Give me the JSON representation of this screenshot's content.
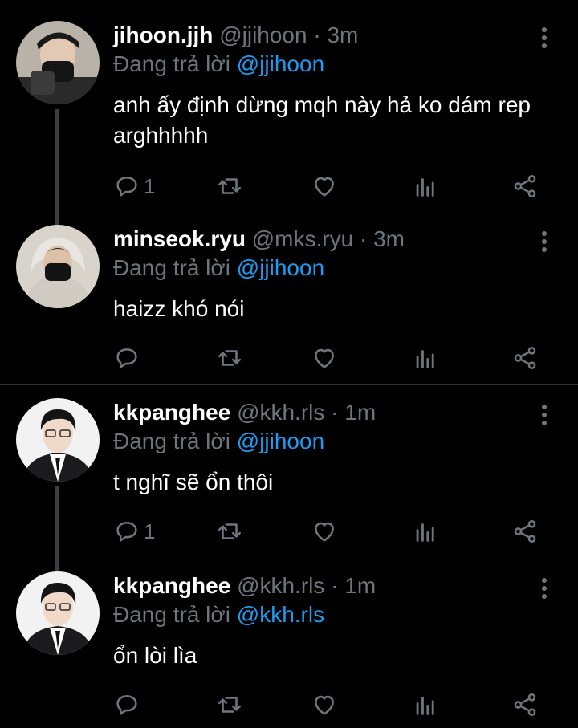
{
  "reply_prefix": "Đang trả lời",
  "tweets": [
    {
      "name": "jihoon.jjh",
      "handle": "@jjihoon",
      "dot": "·",
      "time": "3m",
      "reply_to": "@jjihoon",
      "text": "anh ấy định dừng mqh này hả ko dám rep arghhhhh",
      "reply_count": "1"
    },
    {
      "name": "minseok.ryu",
      "handle": "@mks.ryu",
      "dot": "·",
      "time": "3m",
      "reply_to": "@jjihoon",
      "text": "haizz khó nói",
      "reply_count": ""
    },
    {
      "name": "kkpanghee",
      "handle": "@kkh.rls",
      "dot": "·",
      "time": "1m",
      "reply_to": "@jjihoon",
      "text": "t nghĩ sẽ ổn thôi",
      "reply_count": "1"
    },
    {
      "name": "kkpanghee",
      "handle": "@kkh.rls",
      "dot": "·",
      "time": "1m",
      "reply_to": "@kkh.rls",
      "text": "ổn lòi lìa",
      "reply_count": ""
    }
  ],
  "icons": {
    "reply": "reply-icon",
    "retweet": "retweet-icon",
    "like": "heart-icon",
    "views": "analytics-icon",
    "share": "share-icon",
    "menu": "more-vertical-icon"
  },
  "colors": {
    "background": "#000000",
    "text": "#ffffff",
    "muted": "#6e767d",
    "link": "#1d9bf0"
  }
}
